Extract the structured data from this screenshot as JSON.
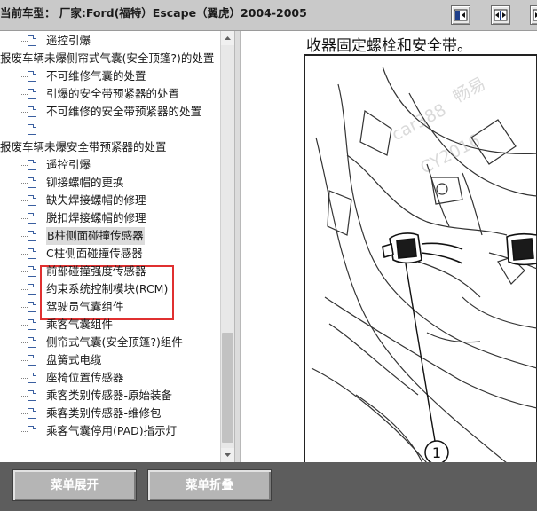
{
  "header": {
    "title": "当前车型：  厂家:Ford(福特）Escape（翼虎）2004-2005",
    "buttons": [
      {
        "icon": "collapse-left-icon"
      },
      {
        "icon": "split-view-icon"
      },
      {
        "icon": "expand-right-icon"
      }
    ]
  },
  "tree": {
    "items": [
      {
        "label": "遥控引爆",
        "level": 2
      },
      {
        "label": "报废车辆未爆侧帘式气囊(安全顶篷?)的处置",
        "level": 1
      },
      {
        "label": "不可维修气囊的处置",
        "level": 2
      },
      {
        "label": "引爆的安全带预紧器的处置",
        "level": 2
      },
      {
        "label": "不可维修的安全带预紧器的处置",
        "level": 2
      },
      {
        "label": "",
        "level": 2
      },
      {
        "label": "报废车辆未爆安全带预紧器的处置",
        "level": 1
      },
      {
        "label": "遥控引爆",
        "level": 2
      },
      {
        "label": "铆接螺帽的更换",
        "level": 2
      },
      {
        "label": "缺失焊接螺帽的修理",
        "level": 2
      },
      {
        "label": "脱扣焊接螺帽的修理",
        "level": 2
      },
      {
        "label": "B柱侧面碰撞传感器",
        "level": 2,
        "selected": true
      },
      {
        "label": "C柱侧面碰撞传感器",
        "level": 2
      },
      {
        "label": "前部碰撞强度传感器",
        "level": 2
      },
      {
        "label": "约束系统控制模块(RCM)",
        "level": 2
      },
      {
        "label": "驾驶员气囊组件",
        "level": 2
      },
      {
        "label": "乘客气囊组件",
        "level": 2
      },
      {
        "label": "侧帘式气囊(安全顶篷?)组件",
        "level": 2
      },
      {
        "label": "盘簧式电缆",
        "level": 2
      },
      {
        "label": "座椅位置传感器",
        "level": 2
      },
      {
        "label": "乘客类别传感器-原始装备",
        "level": 2
      },
      {
        "label": "乘客类别传感器-维修包",
        "level": 2
      },
      {
        "label": "乘客气囊停用(PAD)指示灯",
        "level": 2
      }
    ]
  },
  "diagram": {
    "caption": "收器固定螺栓和安全带。",
    "callout": "1",
    "watermark_lines": [
      "畅易",
      "car388",
      "CY2016"
    ]
  },
  "footer": {
    "expand_label": "菜单展开",
    "collapse_label": "菜单折叠"
  },
  "colors": {
    "header_bg": "#c9c9c9",
    "footer_bg": "#5d5d5d",
    "highlight": "#e03030",
    "button_bg": "#b5b5b5"
  }
}
